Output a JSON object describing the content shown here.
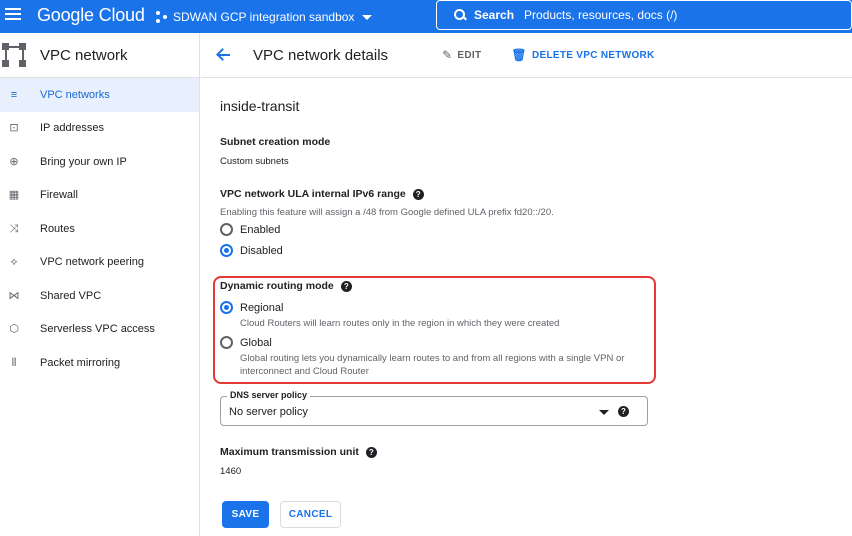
{
  "topbar": {
    "brand": "Google Cloud",
    "project": "SDWAN GCP integration sandbox",
    "search_label": "Search",
    "search_placeholder": "Products, resources, docs (/)"
  },
  "sidebar": {
    "title": "VPC network",
    "items": [
      {
        "label": "VPC networks",
        "icon": "vpc-networks-icon",
        "glyph": "≡"
      },
      {
        "label": "IP addresses",
        "icon": "ip-addresses-icon",
        "glyph": "⊡"
      },
      {
        "label": "Bring your own IP",
        "icon": "globe-icon",
        "glyph": "⊕"
      },
      {
        "label": "Firewall",
        "icon": "firewall-icon",
        "glyph": "▦"
      },
      {
        "label": "Routes",
        "icon": "routes-icon",
        "glyph": "⤨"
      },
      {
        "label": "VPC network peering",
        "icon": "peering-icon",
        "glyph": "⟡"
      },
      {
        "label": "Shared VPC",
        "icon": "shared-vpc-icon",
        "glyph": "⋈"
      },
      {
        "label": "Serverless VPC access",
        "icon": "serverless-icon",
        "glyph": "⬡"
      },
      {
        "label": "Packet mirroring",
        "icon": "packet-mirroring-icon",
        "glyph": "⦀"
      }
    ]
  },
  "header": {
    "title": "VPC network details",
    "edit": "EDIT",
    "delete": "DELETE VPC NETWORK"
  },
  "form": {
    "network_name": "inside-transit",
    "subnet_mode_label": "Subnet creation mode",
    "subnet_mode_value": "Custom subnets",
    "ula_label": "VPC network ULA internal IPv6 range",
    "ula_desc": "Enabling this feature will assign a /48 from Google defined ULA prefix fd20::/20.",
    "ula_enabled": "Enabled",
    "ula_disabled": "Disabled",
    "routing_label": "Dynamic routing mode",
    "regional": "Regional",
    "regional_desc": "Cloud Routers will learn routes only in the region in which they were created",
    "global": "Global",
    "global_desc_1": "Global routing lets you dynamically learn routes to and from all regions with a single VPN or",
    "global_desc_2": "interconnect and Cloud Router",
    "dns_label": "DNS server policy",
    "dns_value": "No server policy",
    "mtu_label": "Maximum transmission unit",
    "mtu_value": "1460",
    "save": "SAVE",
    "cancel": "CANCEL"
  },
  "colors": {
    "accent": "#1a73e8",
    "highlight_border": "#e53935",
    "active_nav_bg": "#e8f0fe"
  }
}
